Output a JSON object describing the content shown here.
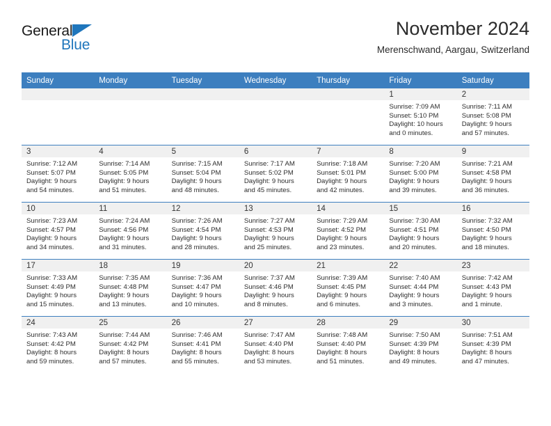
{
  "brand": {
    "name_part1": "General",
    "name_part2": "Blue",
    "accent_color": "#1f76bc"
  },
  "header": {
    "title": "November 2024",
    "subtitle": "Merenschwand, Aargau, Switzerland"
  },
  "theme": {
    "header_row_bg": "#3d7fbf",
    "daynum_band_bg": "#f0f0f0",
    "text_color": "#2d2d2d"
  },
  "weekday_headers": [
    "Sunday",
    "Monday",
    "Tuesday",
    "Wednesday",
    "Thursday",
    "Friday",
    "Saturday"
  ],
  "labels": {
    "sunrise_prefix": "Sunrise: ",
    "sunset_prefix": "Sunset: ",
    "daylight_prefix": "Daylight: "
  },
  "weeks": [
    [
      {
        "empty": true
      },
      {
        "empty": true
      },
      {
        "empty": true
      },
      {
        "empty": true
      },
      {
        "empty": true
      },
      {
        "day": "1",
        "sunrise": "Sunrise: 7:09 AM",
        "sunset": "Sunset: 5:10 PM",
        "daylight_line1": "Daylight: 10 hours",
        "daylight_line2": "and 0 minutes."
      },
      {
        "day": "2",
        "sunrise": "Sunrise: 7:11 AM",
        "sunset": "Sunset: 5:08 PM",
        "daylight_line1": "Daylight: 9 hours",
        "daylight_line2": "and 57 minutes."
      }
    ],
    [
      {
        "day": "3",
        "sunrise": "Sunrise: 7:12 AM",
        "sunset": "Sunset: 5:07 PM",
        "daylight_line1": "Daylight: 9 hours",
        "daylight_line2": "and 54 minutes."
      },
      {
        "day": "4",
        "sunrise": "Sunrise: 7:14 AM",
        "sunset": "Sunset: 5:05 PM",
        "daylight_line1": "Daylight: 9 hours",
        "daylight_line2": "and 51 minutes."
      },
      {
        "day": "5",
        "sunrise": "Sunrise: 7:15 AM",
        "sunset": "Sunset: 5:04 PM",
        "daylight_line1": "Daylight: 9 hours",
        "daylight_line2": "and 48 minutes."
      },
      {
        "day": "6",
        "sunrise": "Sunrise: 7:17 AM",
        "sunset": "Sunset: 5:02 PM",
        "daylight_line1": "Daylight: 9 hours",
        "daylight_line2": "and 45 minutes."
      },
      {
        "day": "7",
        "sunrise": "Sunrise: 7:18 AM",
        "sunset": "Sunset: 5:01 PM",
        "daylight_line1": "Daylight: 9 hours",
        "daylight_line2": "and 42 minutes."
      },
      {
        "day": "8",
        "sunrise": "Sunrise: 7:20 AM",
        "sunset": "Sunset: 5:00 PM",
        "daylight_line1": "Daylight: 9 hours",
        "daylight_line2": "and 39 minutes."
      },
      {
        "day": "9",
        "sunrise": "Sunrise: 7:21 AM",
        "sunset": "Sunset: 4:58 PM",
        "daylight_line1": "Daylight: 9 hours",
        "daylight_line2": "and 36 minutes."
      }
    ],
    [
      {
        "day": "10",
        "sunrise": "Sunrise: 7:23 AM",
        "sunset": "Sunset: 4:57 PM",
        "daylight_line1": "Daylight: 9 hours",
        "daylight_line2": "and 34 minutes."
      },
      {
        "day": "11",
        "sunrise": "Sunrise: 7:24 AM",
        "sunset": "Sunset: 4:56 PM",
        "daylight_line1": "Daylight: 9 hours",
        "daylight_line2": "and 31 minutes."
      },
      {
        "day": "12",
        "sunrise": "Sunrise: 7:26 AM",
        "sunset": "Sunset: 4:54 PM",
        "daylight_line1": "Daylight: 9 hours",
        "daylight_line2": "and 28 minutes."
      },
      {
        "day": "13",
        "sunrise": "Sunrise: 7:27 AM",
        "sunset": "Sunset: 4:53 PM",
        "daylight_line1": "Daylight: 9 hours",
        "daylight_line2": "and 25 minutes."
      },
      {
        "day": "14",
        "sunrise": "Sunrise: 7:29 AM",
        "sunset": "Sunset: 4:52 PM",
        "daylight_line1": "Daylight: 9 hours",
        "daylight_line2": "and 23 minutes."
      },
      {
        "day": "15",
        "sunrise": "Sunrise: 7:30 AM",
        "sunset": "Sunset: 4:51 PM",
        "daylight_line1": "Daylight: 9 hours",
        "daylight_line2": "and 20 minutes."
      },
      {
        "day": "16",
        "sunrise": "Sunrise: 7:32 AM",
        "sunset": "Sunset: 4:50 PM",
        "daylight_line1": "Daylight: 9 hours",
        "daylight_line2": "and 18 minutes."
      }
    ],
    [
      {
        "day": "17",
        "sunrise": "Sunrise: 7:33 AM",
        "sunset": "Sunset: 4:49 PM",
        "daylight_line1": "Daylight: 9 hours",
        "daylight_line2": "and 15 minutes."
      },
      {
        "day": "18",
        "sunrise": "Sunrise: 7:35 AM",
        "sunset": "Sunset: 4:48 PM",
        "daylight_line1": "Daylight: 9 hours",
        "daylight_line2": "and 13 minutes."
      },
      {
        "day": "19",
        "sunrise": "Sunrise: 7:36 AM",
        "sunset": "Sunset: 4:47 PM",
        "daylight_line1": "Daylight: 9 hours",
        "daylight_line2": "and 10 minutes."
      },
      {
        "day": "20",
        "sunrise": "Sunrise: 7:37 AM",
        "sunset": "Sunset: 4:46 PM",
        "daylight_line1": "Daylight: 9 hours",
        "daylight_line2": "and 8 minutes."
      },
      {
        "day": "21",
        "sunrise": "Sunrise: 7:39 AM",
        "sunset": "Sunset: 4:45 PM",
        "daylight_line1": "Daylight: 9 hours",
        "daylight_line2": "and 6 minutes."
      },
      {
        "day": "22",
        "sunrise": "Sunrise: 7:40 AM",
        "sunset": "Sunset: 4:44 PM",
        "daylight_line1": "Daylight: 9 hours",
        "daylight_line2": "and 3 minutes."
      },
      {
        "day": "23",
        "sunrise": "Sunrise: 7:42 AM",
        "sunset": "Sunset: 4:43 PM",
        "daylight_line1": "Daylight: 9 hours",
        "daylight_line2": "and 1 minute."
      }
    ],
    [
      {
        "day": "24",
        "sunrise": "Sunrise: 7:43 AM",
        "sunset": "Sunset: 4:42 PM",
        "daylight_line1": "Daylight: 8 hours",
        "daylight_line2": "and 59 minutes."
      },
      {
        "day": "25",
        "sunrise": "Sunrise: 7:44 AM",
        "sunset": "Sunset: 4:42 PM",
        "daylight_line1": "Daylight: 8 hours",
        "daylight_line2": "and 57 minutes."
      },
      {
        "day": "26",
        "sunrise": "Sunrise: 7:46 AM",
        "sunset": "Sunset: 4:41 PM",
        "daylight_line1": "Daylight: 8 hours",
        "daylight_line2": "and 55 minutes."
      },
      {
        "day": "27",
        "sunrise": "Sunrise: 7:47 AM",
        "sunset": "Sunset: 4:40 PM",
        "daylight_line1": "Daylight: 8 hours",
        "daylight_line2": "and 53 minutes."
      },
      {
        "day": "28",
        "sunrise": "Sunrise: 7:48 AM",
        "sunset": "Sunset: 4:40 PM",
        "daylight_line1": "Daylight: 8 hours",
        "daylight_line2": "and 51 minutes."
      },
      {
        "day": "29",
        "sunrise": "Sunrise: 7:50 AM",
        "sunset": "Sunset: 4:39 PM",
        "daylight_line1": "Daylight: 8 hours",
        "daylight_line2": "and 49 minutes."
      },
      {
        "day": "30",
        "sunrise": "Sunrise: 7:51 AM",
        "sunset": "Sunset: 4:39 PM",
        "daylight_line1": "Daylight: 8 hours",
        "daylight_line2": "and 47 minutes."
      }
    ]
  ]
}
